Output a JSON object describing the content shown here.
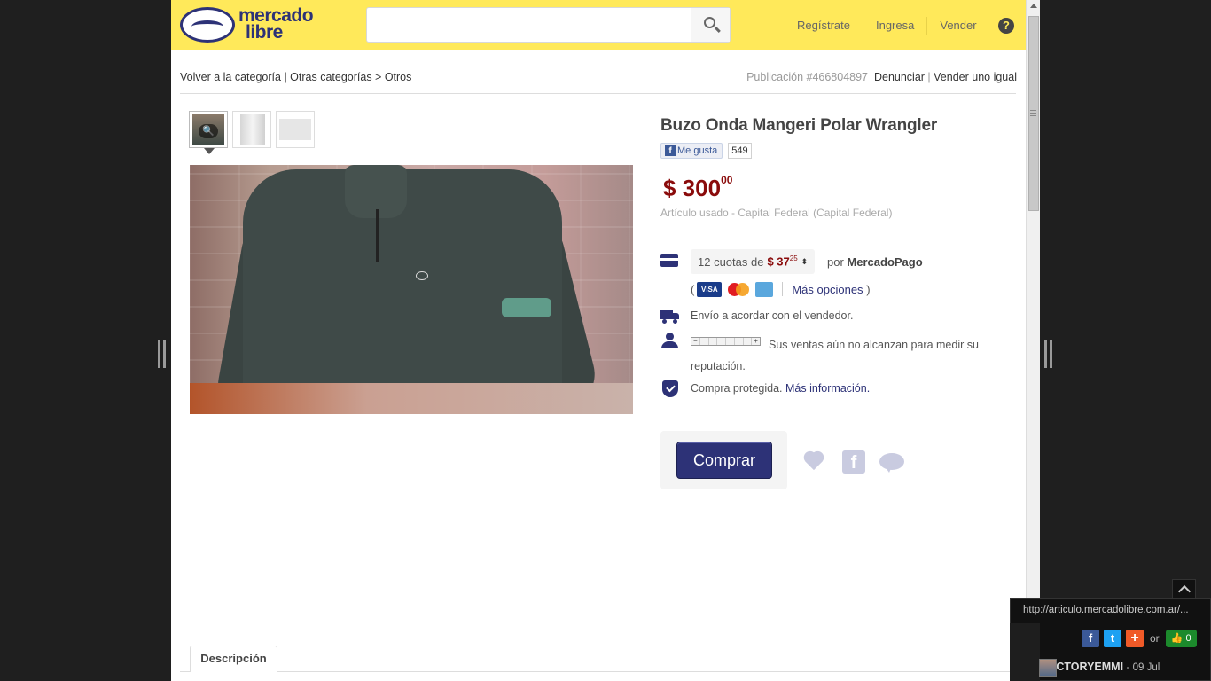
{
  "header": {
    "logo_line1": "mercado",
    "logo_line2": "libre",
    "search_placeholder": "",
    "nav": [
      "Regístrate",
      "Ingresa",
      "Vender"
    ],
    "help_label": "?"
  },
  "breadcrumb": {
    "back": "Volver a la categoría",
    "sep1": " | ",
    "other": "Otras categorías",
    "sep2": " > ",
    "current": "Otros"
  },
  "publication": {
    "id_text": "Publicación #466804897",
    "report": "Denunciar",
    "sep": " | ",
    "sell_same": "Vender uno igual"
  },
  "gallery": {
    "zoom_glyph": "🔍"
  },
  "item": {
    "title": "Buzo Onda Mangeri Polar Wrangler",
    "fb_like_label": "Me gusta",
    "fb_like_count": "549",
    "price": "$ 300",
    "price_cents": "00",
    "condition": "Artículo usado -  Capital Federal (Capital Federal)"
  },
  "payment": {
    "installments_prefix": "12 cuotas de",
    "installment_amount": "$ 37",
    "installment_cents": "25",
    "sort_glyph": "⬍",
    "por": "por",
    "provider": "MercadoPago",
    "open_paren": "(",
    "close_paren": ")",
    "cards": [
      "VISA",
      "MasterCard",
      "AMEX"
    ],
    "more_options": "Más opciones"
  },
  "shipping": {
    "text": "Envío a acordar con el vendedor."
  },
  "seller": {
    "reputation_text": "Sus ventas aún no alcanzan para medir su reputación.",
    "meter_minus": "−",
    "meter_plus": "+"
  },
  "protection": {
    "text": "Compra protegida.",
    "link": "Más información."
  },
  "actions": {
    "buy": "Comprar",
    "fb_glyph": "f"
  },
  "tabs": {
    "description": "Descripción"
  },
  "share_panel": {
    "url": "http://articulo.mercadolibre.com.ar/...",
    "fb": "f",
    "tw": "t",
    "plus": "+",
    "or": "or",
    "like_count": "0",
    "user": "HECTORYEMMI",
    "date": "09 Jul"
  },
  "colors": {
    "header_bg": "#ffe95a",
    "brand_blue": "#2d3277",
    "price_red": "#8a0b0b"
  }
}
